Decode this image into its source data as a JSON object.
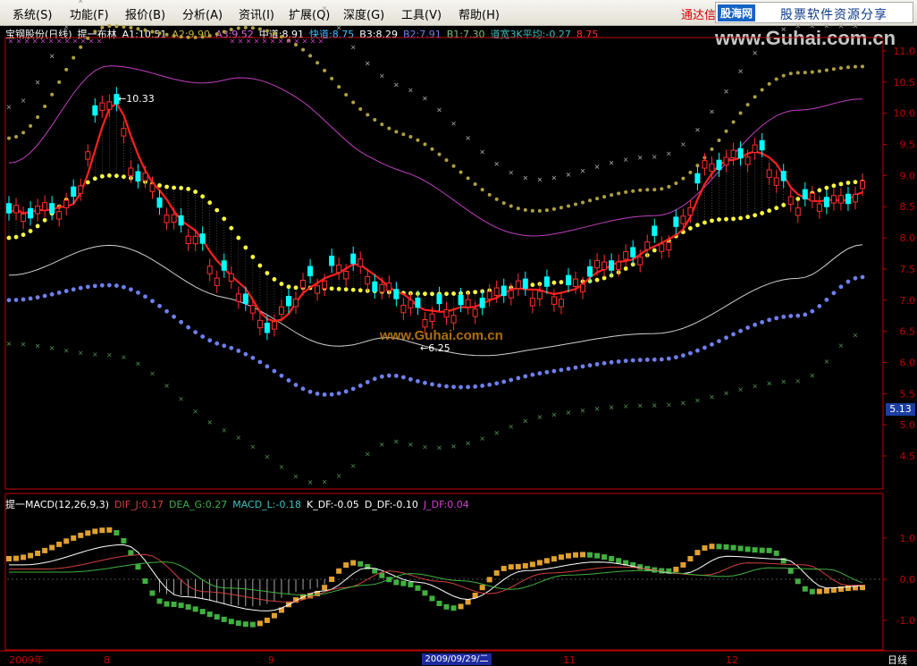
{
  "menu": [
    "系统(S)",
    "功能(F)",
    "报价(B)",
    "分析(A)",
    "资讯(I)",
    "扩展(Q)",
    "深度(G)",
    "工具(V)",
    "帮助(H)"
  ],
  "vendor": "通达信",
  "brand": {
    "logo": "股海网",
    "text": "股票软件资源分享",
    "url": "www.Guhai.com.cn"
  },
  "watermark": "www.Guhai.com.cn",
  "main_info": [
    {
      "text": "宝钢股份(日线)",
      "color": "#ffffff"
    },
    {
      "text": "提一布林",
      "color": "#ffffff"
    },
    {
      "text": "A1:10.51",
      "color": "#ffffff"
    },
    {
      "text": "A2:9.90",
      "color": "#c8b43c"
    },
    {
      "text": "A3:9.52",
      "color": "#e060e0"
    },
    {
      "text": "中道:8.91",
      "color": "#ffffff"
    },
    {
      "text": "快道:8.75",
      "color": "#40c0ff"
    },
    {
      "text": "B3:8.29",
      "color": "#ffffff"
    },
    {
      "text": "B2:7.91",
      "color": "#6f7ff0"
    },
    {
      "text": "B1:7.30",
      "color": "#80c080"
    },
    {
      "text": "道宽3K平均:-0.27",
      "color": "#40c0c0"
    },
    {
      "text": "8.75",
      "color": "#ff3030"
    }
  ],
  "ind_info": [
    {
      "text": "提一MACD(12,26,9,3)",
      "color": "#ffffff"
    },
    {
      "text": "DIF_J:0.17",
      "color": "#d04040"
    },
    {
      "text": "DEA_G:0.27",
      "color": "#40b040"
    },
    {
      "text": "MACD_L:-0.18",
      "color": "#40c0c0"
    },
    {
      "text": "K_DF:-0.05",
      "color": "#ffffff"
    },
    {
      "text": "D_DF:-0.10",
      "color": "#ffffff"
    },
    {
      "text": "J_DF:0.04",
      "color": "#d040d0"
    }
  ],
  "price_axis": [
    "11.0",
    "10.5",
    "10.0",
    "9.5",
    "9.0",
    "8.5",
    "8.0",
    "7.5",
    "7.0",
    "6.5",
    "6.0",
    "5.5",
    "5.0",
    "4.5"
  ],
  "ind_axis": [
    "1.0",
    "0.0",
    "-1.0"
  ],
  "current_price": "5.13",
  "annotations": {
    "high": "10.33",
    "low": "6.25"
  },
  "date_labels": [
    "2009年",
    "8",
    "9",
    "11",
    "12"
  ],
  "cursor_date": "2009/09/29/二",
  "period": "日线",
  "colors": {
    "up": "#ff3030",
    "down": "#00ffff",
    "bg": "#000000",
    "axis": "#c00000"
  }
}
